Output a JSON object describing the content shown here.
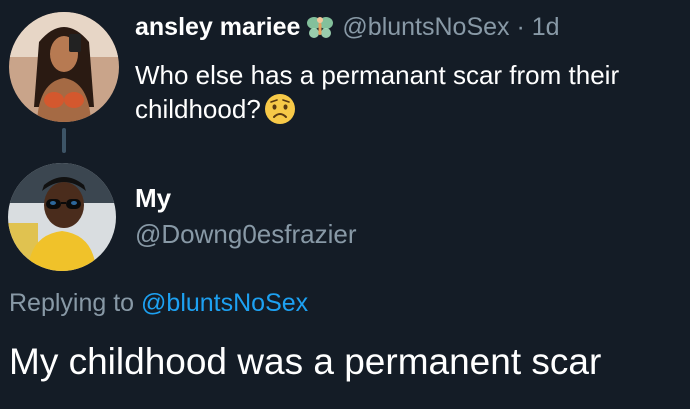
{
  "original_tweet": {
    "display_name": "ansley mariee",
    "handle": "@bluntsNoSex",
    "separator": "·",
    "time_ago": "1d",
    "text": "Who else has a permanant scar from their childhood?",
    "name_emoji": "fairy-icon",
    "text_emoji": "worried-face-icon"
  },
  "reply": {
    "display_name": "My",
    "handle": "@Downg0esfrazier",
    "replying_prefix": "Replying to",
    "replying_mention": "@bluntsNoSex",
    "text": "My childhood was a permanent scar"
  },
  "colors": {
    "background": "#141c26",
    "primary_text": "#ffffff",
    "secondary_text": "#8899a6",
    "link": "#1da1f2",
    "thread_line": "#3d5466"
  }
}
